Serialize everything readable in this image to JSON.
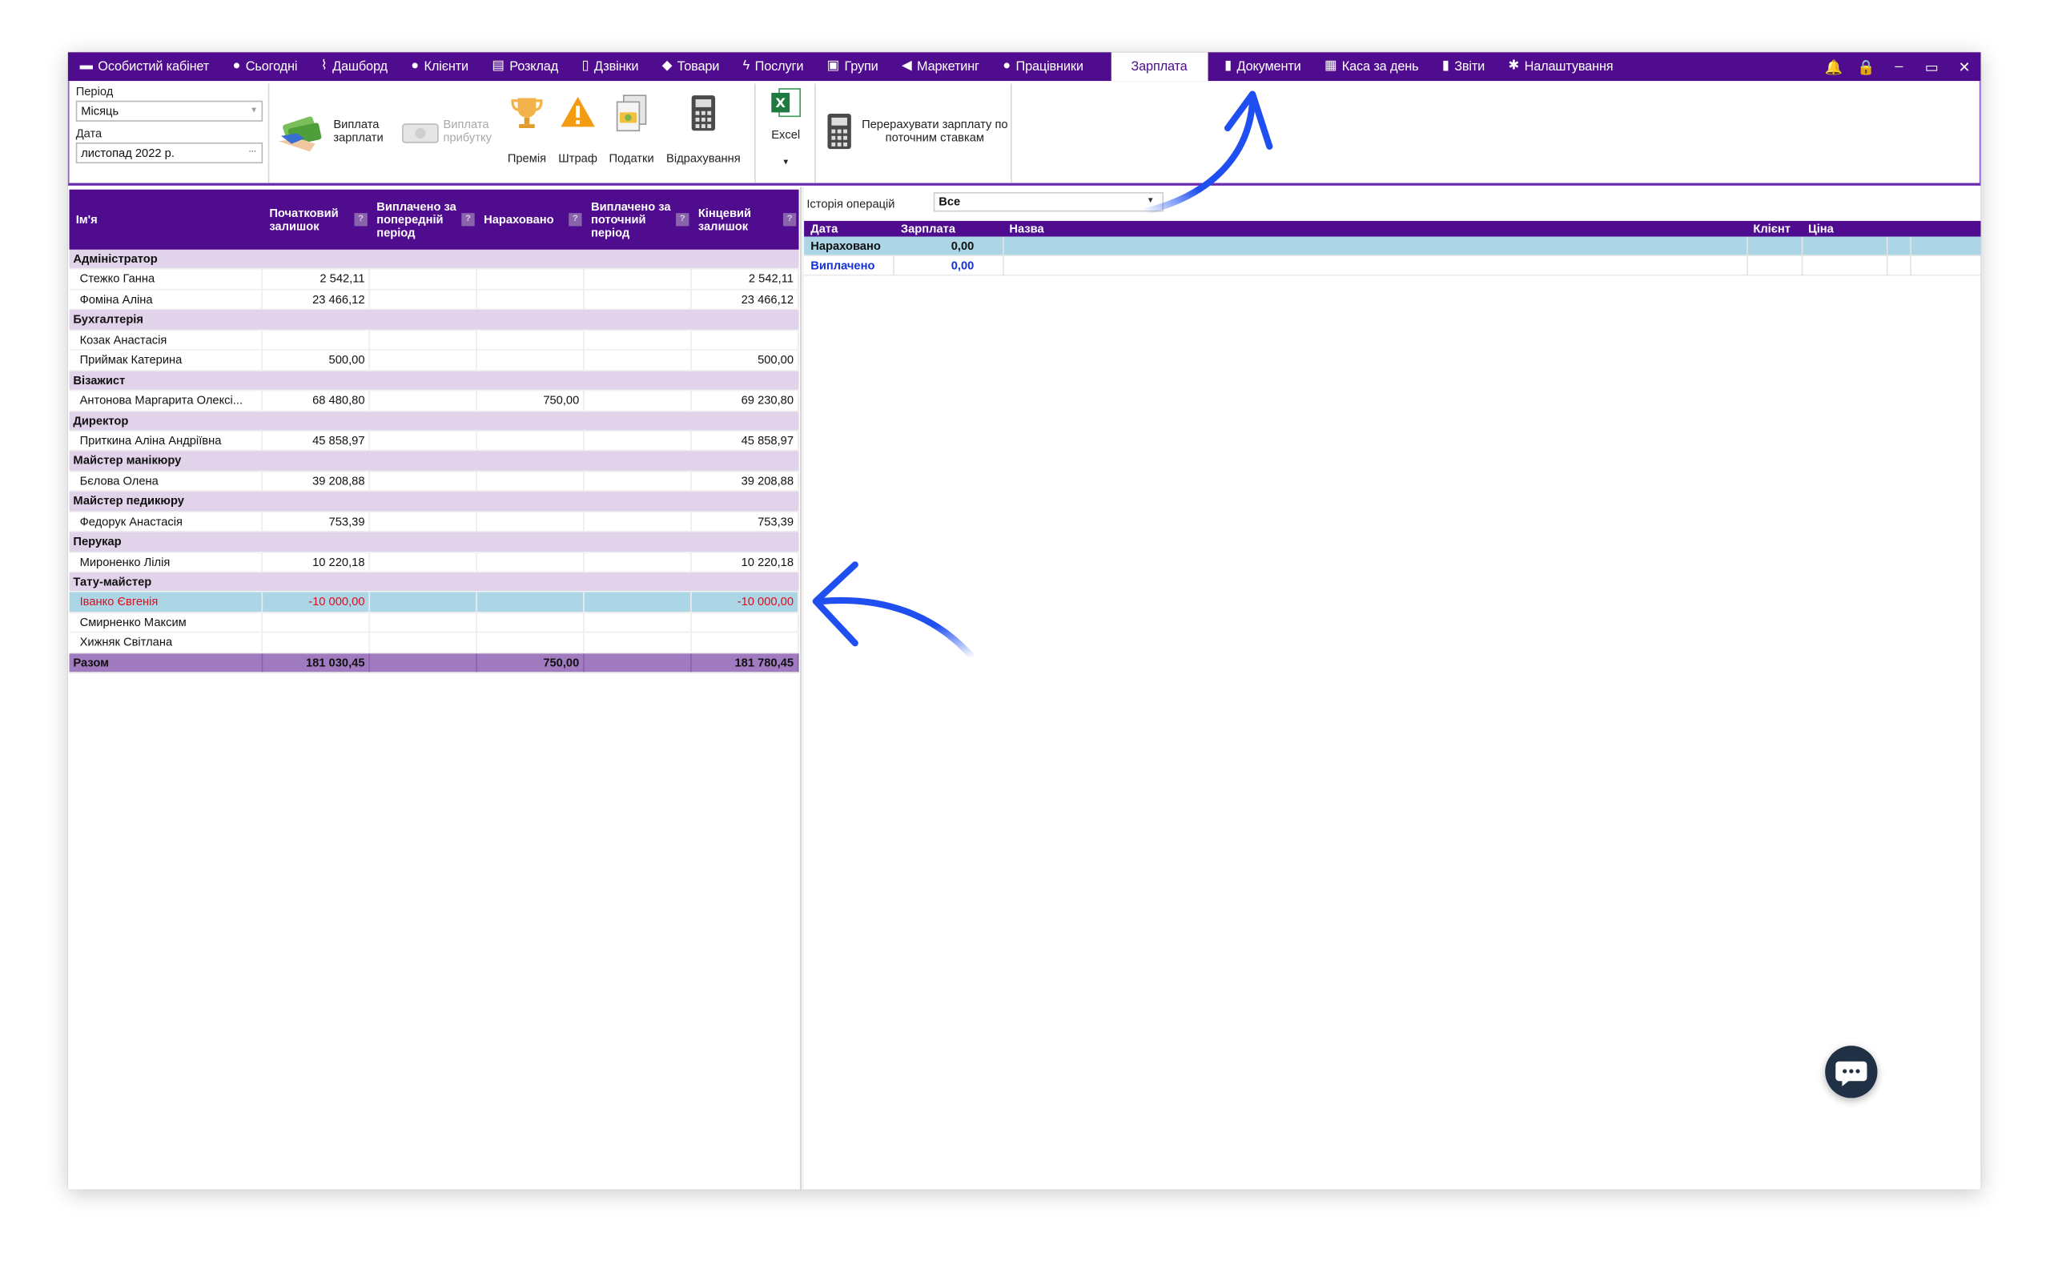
{
  "nav": {
    "items": [
      {
        "label": "Особистий кабінет",
        "icon": "briefcase-icon",
        "glyph": "▬"
      },
      {
        "label": "Сьогодні",
        "icon": "clock-icon",
        "glyph": "●"
      },
      {
        "label": "Дашборд",
        "icon": "pulse-icon",
        "glyph": "⌇"
      },
      {
        "label": "Клієнти",
        "icon": "user-circle-icon",
        "glyph": "●"
      },
      {
        "label": "Розклад",
        "icon": "calendar-icon",
        "glyph": "▤"
      },
      {
        "label": "Дзвінки",
        "icon": "phone-icon",
        "glyph": "▯"
      },
      {
        "label": "Товари",
        "icon": "box-icon",
        "glyph": "◆"
      },
      {
        "label": "Послуги",
        "icon": "bolt-icon",
        "glyph": "ϟ"
      },
      {
        "label": "Групи",
        "icon": "group-icon",
        "glyph": "▣"
      },
      {
        "label": "Маркетинг",
        "icon": "megaphone-icon",
        "glyph": "◀"
      },
      {
        "label": "Працівники",
        "icon": "person-icon",
        "glyph": "●"
      }
    ],
    "active": "Зарплата",
    "items_after": [
      {
        "label": "Документи",
        "icon": "document-icon",
        "glyph": "▮"
      },
      {
        "label": "Каса за день",
        "icon": "calculator-icon",
        "glyph": "▦"
      },
      {
        "label": "Звіти",
        "icon": "bar-chart-icon",
        "glyph": "▮"
      },
      {
        "label": "Налаштування",
        "icon": "gear-icon",
        "glyph": "✱"
      }
    ]
  },
  "ribbon": {
    "period_label": "Період",
    "period_value": "Місяць",
    "date_label": "Дата",
    "date_value": "листопад  2022 р.",
    "date_button": "...",
    "pay_salary": "Виплата зарплати",
    "pay_profit": "Виплата прибутку",
    "bonus": "Премія",
    "fine": "Штраф",
    "taxes": "Податки",
    "deductions": "Відрахування",
    "excel": "Excel",
    "recalc": "Перерахувати зарплату по поточним ставкам"
  },
  "left_grid": {
    "headers": [
      "Ім'я",
      "Початковий залишок",
      "Виплачено за попередній період",
      "Нараховано",
      "Виплачено за поточний період",
      "Кінцевий залишок"
    ],
    "rows": [
      {
        "type": "group",
        "name": "Адміністратор"
      },
      {
        "type": "emp",
        "name": "Стежко Ганна",
        "start": "2 542,11",
        "paid_prev": "",
        "accrued": "",
        "paid_cur": "",
        "end": "2 542,11"
      },
      {
        "type": "emp",
        "name": "Фоміна Аліна",
        "start": "23 466,12",
        "paid_prev": "",
        "accrued": "",
        "paid_cur": "",
        "end": "23 466,12"
      },
      {
        "type": "group",
        "name": "Бухгалтерія"
      },
      {
        "type": "emp",
        "name": "Козак Анастасія",
        "start": "",
        "paid_prev": "",
        "accrued": "",
        "paid_cur": "",
        "end": ""
      },
      {
        "type": "emp",
        "name": "Приймак Катерина",
        "start": "500,00",
        "paid_prev": "",
        "accrued": "",
        "paid_cur": "",
        "end": "500,00"
      },
      {
        "type": "group",
        "name": "Візажист"
      },
      {
        "type": "emp",
        "name": "Антонова Маргарита Олексі...",
        "start": "68 480,80",
        "paid_prev": "",
        "accrued": "750,00",
        "paid_cur": "",
        "end": "69 230,80"
      },
      {
        "type": "group",
        "name": "Директор"
      },
      {
        "type": "emp",
        "name": "Приткина Аліна Андріївна",
        "start": "45 858,97",
        "paid_prev": "",
        "accrued": "",
        "paid_cur": "",
        "end": "45 858,97"
      },
      {
        "type": "group",
        "name": "Майстер манікюру"
      },
      {
        "type": "emp",
        "name": "Бєлова Олена",
        "start": "39 208,88",
        "paid_prev": "",
        "accrued": "",
        "paid_cur": "",
        "end": "39 208,88"
      },
      {
        "type": "group",
        "name": "Майстер педикюру"
      },
      {
        "type": "emp",
        "name": "Федорук Анастасія",
        "start": "753,39",
        "paid_prev": "",
        "accrued": "",
        "paid_cur": "",
        "end": "753,39"
      },
      {
        "type": "group",
        "name": "Перукар"
      },
      {
        "type": "emp",
        "name": "Мироненко Лілія",
        "start": "10 220,18",
        "paid_prev": "",
        "accrued": "",
        "paid_cur": "",
        "end": "10 220,18"
      },
      {
        "type": "group",
        "name": "Тату-майстер"
      },
      {
        "type": "sel",
        "name": "Іванко Євгенія",
        "start": "-10 000,00",
        "paid_prev": "",
        "accrued": "",
        "paid_cur": "",
        "end": "-10 000,00"
      },
      {
        "type": "emp",
        "name": "Смирненко Максим",
        "start": "",
        "paid_prev": "",
        "accrued": "",
        "paid_cur": "",
        "end": ""
      },
      {
        "type": "emp",
        "name": "Хижняк Світлана",
        "start": "",
        "paid_prev": "",
        "accrued": "",
        "paid_cur": "",
        "end": ""
      },
      {
        "type": "total",
        "name": "Разом",
        "start": "181 030,45",
        "paid_prev": "",
        "accrued": "750,00",
        "paid_cur": "",
        "end": "181 780,45"
      }
    ]
  },
  "right_grid": {
    "history_label": "Історія операцій",
    "history_value": "Все",
    "headers": {
      "date": "Дата",
      "salary": "Зарплата",
      "name": "Назва",
      "client": "Клієнт",
      "price": "Ціна"
    },
    "rows": [
      {
        "label": "Нараховано",
        "value": "0,00"
      },
      {
        "label": "Виплачено",
        "value": "0,00"
      }
    ]
  },
  "colors": {
    "nav_bg": "#500c8e",
    "group_bg": "#e0d3ea",
    "total_bg": "#a07bc0",
    "selected_bg": "#acd6e5",
    "negative": "#e00b1d",
    "arrow": "#1f4ff0"
  }
}
